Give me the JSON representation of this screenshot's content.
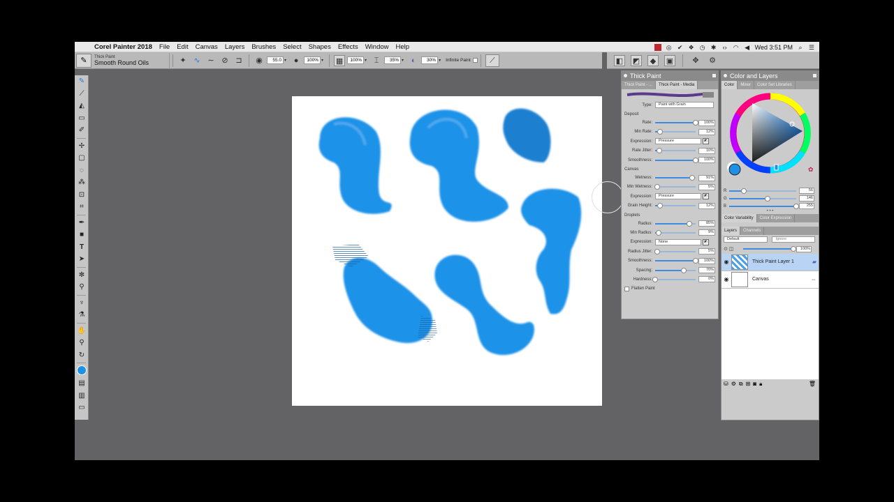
{
  "menubar": {
    "app_name": "Corel Painter 2018",
    "menus": [
      "File",
      "Edit",
      "Canvas",
      "Layers",
      "Brushes",
      "Select",
      "Shapes",
      "Effects",
      "Window",
      "Help"
    ],
    "clock": "Wed 3:51 PM"
  },
  "propbar": {
    "brush_category": "Thick Paint",
    "brush_variant": "Smooth Round Oils",
    "size": "55.0",
    "opacity": "100%",
    "resat": "100%",
    "bleed": "35%",
    "mix": "30%",
    "infinite_paint": "Infinite Paint"
  },
  "thick_paint_panel": {
    "title": "Thick Paint",
    "tabs": [
      "Thick Paint - ...",
      "Thick Paint - Media"
    ],
    "type_label": "Type:",
    "type_value": "Paint with Grain",
    "deposit": {
      "heading": "Deposit",
      "rows": [
        {
          "label": "Rate:",
          "value": "100%",
          "pct": 100
        },
        {
          "label": "Min Rate:",
          "value": "12%",
          "pct": 12
        },
        {
          "label": "Expression:",
          "select": "Pressure"
        },
        {
          "label": "Rate Jitter:",
          "value": "10%",
          "pct": 10
        },
        {
          "label": "Smoothness:",
          "value": "100%",
          "pct": 100
        }
      ]
    },
    "canvas": {
      "heading": "Canvas",
      "rows": [
        {
          "label": "Wetness:",
          "value": "91%",
          "pct": 91
        },
        {
          "label": "Min Wetness:",
          "value": "5%",
          "pct": 5
        },
        {
          "label": "Expression:",
          "select": "Pressure"
        },
        {
          "label": "Grain Height:",
          "value": "12%",
          "pct": 12
        }
      ]
    },
    "droplets": {
      "heading": "Droplets",
      "rows": [
        {
          "label": "Radius:",
          "value": "85%",
          "pct": 85
        },
        {
          "label": "Min Radius:",
          "value": "9%",
          "pct": 9
        },
        {
          "label": "Expression:",
          "select": "None"
        },
        {
          "label": "Radius Jitter:",
          "value": "5%",
          "pct": 5
        },
        {
          "label": "Smoothness:",
          "value": "100%",
          "pct": 100
        },
        {
          "label": "Spacing:",
          "value": "70%",
          "pct": 70
        },
        {
          "label": "Hardness:",
          "value": "0%",
          "pct": 0
        }
      ]
    },
    "flatten_label": "Flatten Paint"
  },
  "color_panel": {
    "title": "Color and Layers",
    "tabs": [
      "Color",
      "Mixer",
      "Color Set Libraries"
    ],
    "rgb": [
      {
        "label": "R",
        "value": "56",
        "pct": 22
      },
      {
        "label": "G",
        "value": "146",
        "pct": 57
      },
      {
        "label": "B",
        "value": "255",
        "pct": 100
      }
    ],
    "subtabs": [
      "Color Variability",
      "Color Expression"
    ],
    "layer_tabs": [
      "Layers",
      "Channels"
    ],
    "composite": "Default",
    "ignore": "Ignore",
    "opacity": "100%",
    "layers": [
      {
        "name": "Thick Paint Layer 1",
        "selected": true
      },
      {
        "name": "Canvas",
        "selected": false
      }
    ]
  },
  "colors": {
    "paint_blue": "#1e90e6",
    "workspace": "#636366"
  }
}
